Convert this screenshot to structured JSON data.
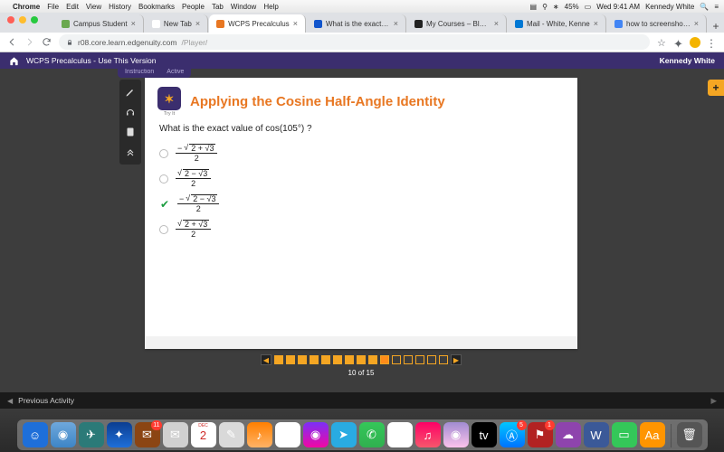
{
  "mac_menu": {
    "app": "Chrome",
    "items": [
      "File",
      "Edit",
      "View",
      "History",
      "Bookmarks",
      "People",
      "Tab",
      "Window",
      "Help"
    ],
    "battery_pct": "45%",
    "clock": "Wed 9:41 AM",
    "user": "Kennedy White"
  },
  "tabs": [
    {
      "label": "Campus Student",
      "favicon": "#6aa84f",
      "active": false
    },
    {
      "label": "New Tab",
      "favicon": "#ffffff",
      "active": false
    },
    {
      "label": "WCPS Precalculus",
      "favicon": "#e87722",
      "active": true
    },
    {
      "label": "What is the exact va",
      "favicon": "#1155cc",
      "active": false
    },
    {
      "label": "My Courses – Blackb",
      "favicon": "#222222",
      "active": false
    },
    {
      "label": "Mail - White, Kenne",
      "favicon": "#0078d4",
      "active": false
    },
    {
      "label": "how to screenshot o",
      "favicon": "#4285f4",
      "active": false
    }
  ],
  "address": {
    "url_host": "r08.core.learn.edgenuity.com",
    "url_path": "/Player/"
  },
  "coursebar": {
    "title": "WCPS Precalculus - Use This Version",
    "user": "Kennedy White"
  },
  "subnav": {
    "a": "Instruction",
    "b": "Active"
  },
  "lesson": {
    "tryit_label": "Try It",
    "title": "Applying the Cosine Half-Angle Identity",
    "question": "What is the exact value of cos(105°) ?",
    "choices": [
      {
        "sign": "−",
        "inner_sign": "+",
        "selected": false
      },
      {
        "sign": "",
        "inner_sign": "−",
        "selected": false
      },
      {
        "sign": "−",
        "inner_sign": "−",
        "selected": true
      },
      {
        "sign": "",
        "inner_sign": "+",
        "selected": false
      }
    ]
  },
  "pager": {
    "total": 15,
    "current": 10,
    "label": "10 of 15"
  },
  "activity": {
    "prev": "Previous Activity"
  },
  "dock": [
    {
      "bg": "#1e6fd9",
      "glyph": "☺"
    },
    {
      "bg": "linear-gradient(#6fa8dc,#3d85c6)",
      "glyph": "◉"
    },
    {
      "bg": "#2b7a78",
      "glyph": "✈"
    },
    {
      "bg": "linear-gradient(#0b3d91,#1e6fd9)",
      "glyph": "✦"
    },
    {
      "bg": "#8b4513",
      "glyph": "✉",
      "badge": "11"
    },
    {
      "bg": "#d0d0d0",
      "glyph": "✉"
    },
    {
      "bg": "#ffffff",
      "glyph": "2",
      "text": "#cf2a27",
      "sub": "DEC"
    },
    {
      "bg": "#d9d9d9",
      "glyph": "✎"
    },
    {
      "bg": "linear-gradient(#ff7f00,#ffb366)",
      "glyph": "♪"
    },
    {
      "bg": "#ffffff",
      "glyph": "✓"
    },
    {
      "bg": "linear-gradient(#7b2ff7,#f107a3)",
      "glyph": "◉"
    },
    {
      "bg": "#29abe2",
      "glyph": "➤"
    },
    {
      "bg": "linear-gradient(#34c759,#30b04f)",
      "glyph": "✆"
    },
    {
      "bg": "#ffffff",
      "glyph": "▦"
    },
    {
      "bg": "linear-gradient(#f06,#f5576c)",
      "glyph": "♫"
    },
    {
      "bg": "linear-gradient(#a18cd1,#fbc2eb)",
      "glyph": "◉"
    },
    {
      "bg": "#000000",
      "glyph": "tv"
    },
    {
      "bg": "linear-gradient(#00c6ff,#0072ff)",
      "glyph": "Ⓐ",
      "badge": "5"
    },
    {
      "bg": "#b22222",
      "glyph": "⚑",
      "badge": "1"
    },
    {
      "bg": "#8e44ad",
      "glyph": "☁"
    },
    {
      "bg": "#3b5998",
      "glyph": "W"
    },
    {
      "bg": "#34c759",
      "glyph": "▭"
    },
    {
      "bg": "#ff9500",
      "glyph": "Aa"
    },
    {
      "bg": "#555555",
      "glyph": "🗑"
    }
  ]
}
